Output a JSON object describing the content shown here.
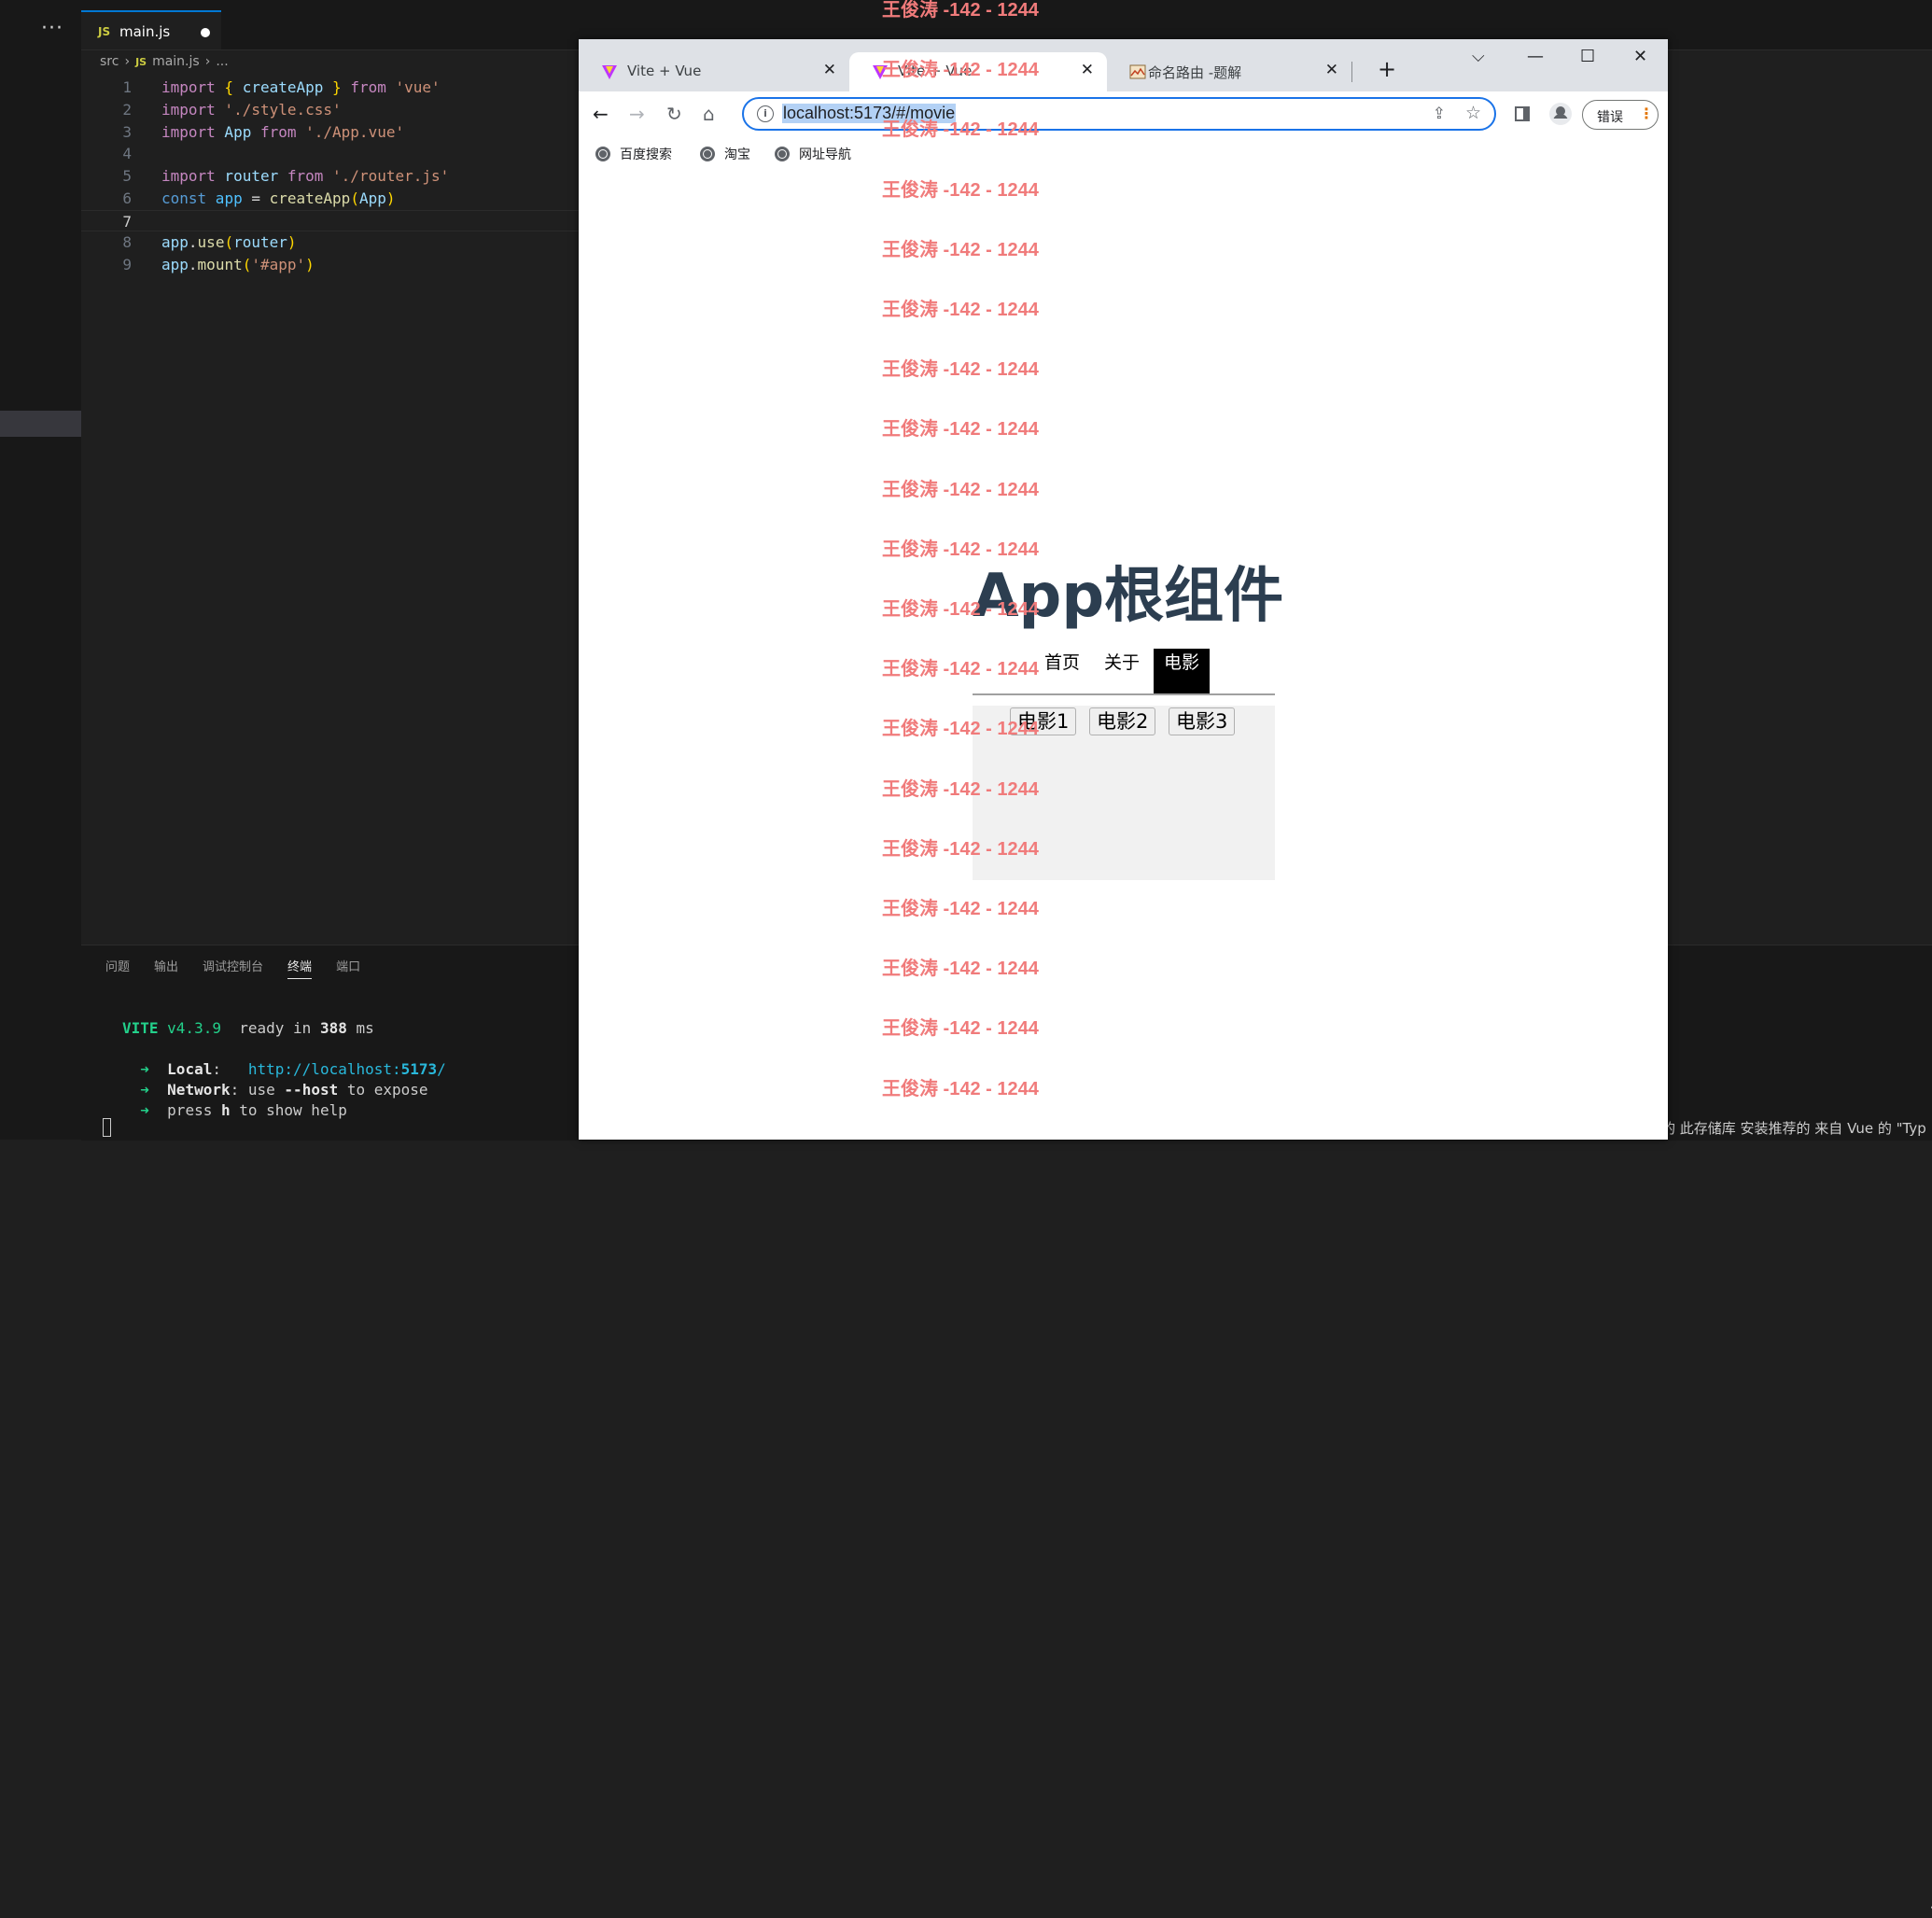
{
  "editor": {
    "tab_badge": "JS",
    "tab_name": "main.js",
    "breadcrumb": {
      "folder": "src",
      "badge": "JS",
      "file": "main.js",
      "more": "..."
    },
    "lines": [
      {
        "n": "1"
      },
      {
        "n": "2"
      },
      {
        "n": "3"
      },
      {
        "n": "4"
      },
      {
        "n": "5"
      },
      {
        "n": "6"
      },
      {
        "n": "7"
      },
      {
        "n": "8"
      },
      {
        "n": "9"
      }
    ],
    "code": {
      "l1_import": "import",
      "l1_a": " { ",
      "l1_fn": "createApp",
      "l1_b": " } ",
      "l1_from": "from",
      "l1_str": " 'vue'",
      "l2_import": "import",
      "l2_str": " './style.css'",
      "l3_import": "import",
      "l3_var": " App",
      "l3_from": " from",
      "l3_str": " './App.vue'",
      "l5_import": "import",
      "l5_var": " router",
      "l5_from": " from",
      "l5_str": " './router.js'",
      "l6_const": "const",
      "l6_var": " app",
      "l6_eq": " = ",
      "l6_fn": "createApp",
      "l6_p1": "(",
      "l6_arg": "App",
      "l6_p2": ")",
      "l8_obj": "app",
      "l8_dot": ".",
      "l8_fn": "use",
      "l8_p1": "(",
      "l8_arg": "router",
      "l8_p2": ")",
      "l9_obj": "app",
      "l9_dot": ".",
      "l9_fn": "mount",
      "l9_p1": "(",
      "l9_str": "'#app'",
      "l9_p2": ")"
    }
  },
  "panel": {
    "tabs": [
      "问题",
      "输出",
      "调试控制台",
      "终端",
      "端口"
    ],
    "active_tab": "终端",
    "terminal": {
      "vite": "VITE",
      "version": " v4.3.9",
      "ready": "  ready in ",
      "ms_num": "388",
      "ms": " ms",
      "arrow": "➜",
      "local_label": "Local",
      "local_url_a": "http://localhost:",
      "local_port": "5173",
      "local_url_b": "/",
      "network_label": "Network",
      "network_a": " use ",
      "network_flag": "--host",
      "network_b": " to expose",
      "help_a": "  press ",
      "help_key": "h",
      "help_b": " to show help"
    },
    "right_plus": "+",
    "status_right": "的 此存储库 安装推荐的 来自 Vue 的 \"Typ"
  },
  "browser": {
    "tabs": [
      {
        "label": "Vite + Vue",
        "close": "✕"
      },
      {
        "label": "Vite + Vue",
        "close": "✕"
      },
      {
        "label": "命名路由 -题解",
        "close": "✕"
      }
    ],
    "new_tab": "+",
    "address": "localhost:5173/#/movie",
    "error_button": "错误",
    "bookmarks": [
      "百度搜索",
      "淘宝",
      "网址导航"
    ]
  },
  "app": {
    "title": "App根组件",
    "nav": [
      "首页",
      "关于",
      "电影"
    ],
    "active_nav": "电影",
    "movies": [
      "电影1",
      "电影2",
      "电影3"
    ]
  },
  "watermark": {
    "text": "王俊涛 -142 - 1244"
  },
  "colors": {
    "vscode_bg": "#1f1f1f",
    "vue_title": "#2c3e50",
    "watermark": "#f07b7b",
    "omnibox_border": "#1a73e8"
  }
}
